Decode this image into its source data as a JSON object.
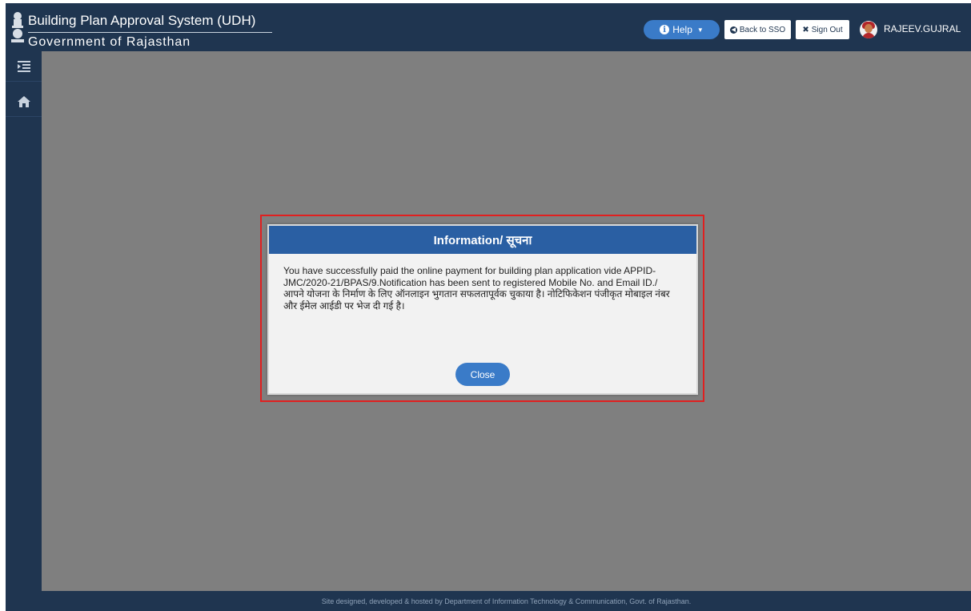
{
  "header": {
    "app_title": "Building Plan Approval System (UDH)",
    "app_subtitle": "Government of Rajasthan",
    "help_label": "Help",
    "back_to_sso_label": "Back to SSO",
    "sign_out_label": "Sign Out",
    "username": "RAJEEV.GUJRAL"
  },
  "sidebar": {
    "items": [
      {
        "icon": "menu-toggle-icon"
      },
      {
        "icon": "home-icon"
      }
    ]
  },
  "modal": {
    "title": "Information/ सूचना",
    "message_en": "You have successfully paid the online payment for building plan application vide APPID- JMC/2020-21/BPAS/9.Notification has been sent to registered Mobile No. and Email ID./",
    "message_hi": "आपने योजना के निर्माण के लिए ऑनलाइन भुगतान सफलतापूर्वक चुकाया है। नोटिफिकेशन पंजीकृत मोबाइल नंबर और ईमेल आईडी पर भेज दी गई है।",
    "close_label": "Close"
  },
  "footer": {
    "text": "Site designed, developed & hosted by Department of Information Technology & Communication, Govt. of Rajasthan."
  },
  "colors": {
    "header_bg": "#1f3550",
    "modal_header": "#2a5fa3",
    "button_blue": "#3a7bc8",
    "overlay": "#7f7f7f",
    "highlight_border": "#e02020"
  }
}
